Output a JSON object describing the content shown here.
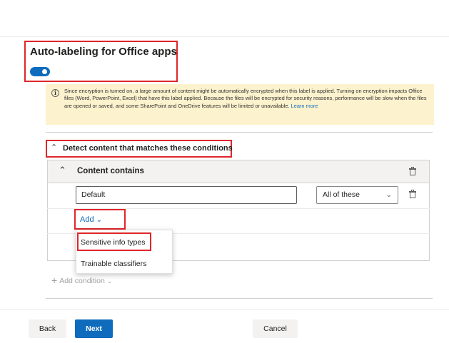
{
  "section": {
    "title": "Auto-labeling for Office apps",
    "toggle_on": true,
    "accent_color": "#0f6cbd",
    "highlight_color": "#e0262b"
  },
  "warning": {
    "icon": "info-icon",
    "text": "Since encryption is turned on, a large amount of content might be automatically encrypted when this label is applied. Turning on encryption impacts Office files (Word, PowerPoint, Excel) that have this label applied. Because the files will be encrypted for security reasons, performance will be slow when the files are opened or saved, and some SharePoint and OneDrive features will be limited or unavailable.",
    "link": "Learn more"
  },
  "conditions": {
    "heading": "Detect content that matches these conditions",
    "group_title": "Content contains",
    "group_name_value": "Default",
    "match_option": "All of these",
    "add_label": "Add",
    "add_menu": [
      "Sensitive info types",
      "Trainable classifiers"
    ],
    "add_condition_label": "Add condition"
  },
  "footer": {
    "back": "Back",
    "next": "Next",
    "cancel": "Cancel"
  }
}
